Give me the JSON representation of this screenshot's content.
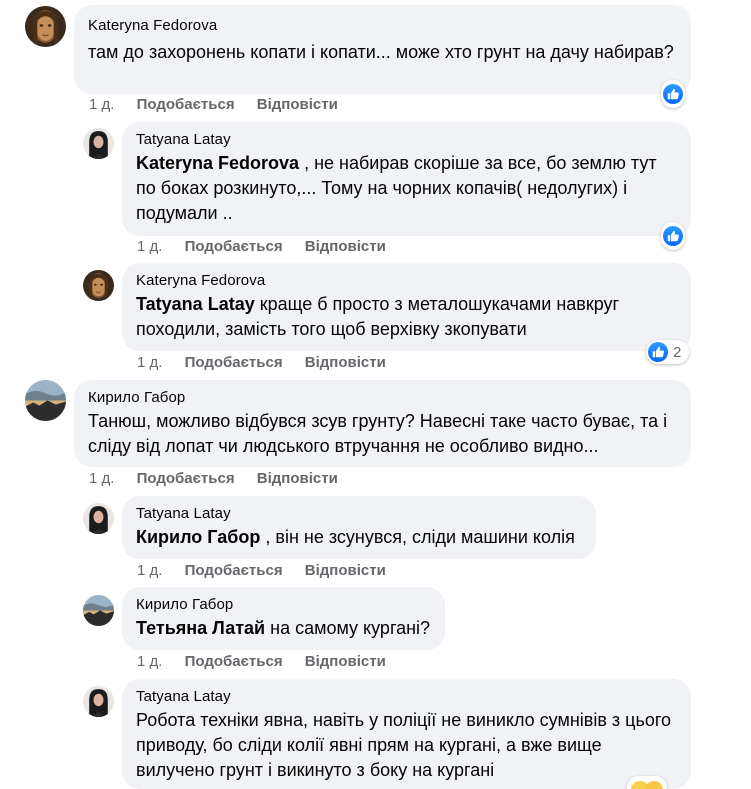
{
  "comments": [
    {
      "author": "Kateryna Fedorova",
      "text": "там до захоронень копати і копати... може хто грунт на дачу набирав?",
      "time": "1 д.",
      "like_label": "Подобається",
      "reply_label": "Відповісти",
      "reaction_icon": "like-icon",
      "avatar_icon": "portrait-avatar"
    },
    {
      "author": "Tatyana Latay",
      "mention": "Kateryna Fedorova",
      "text": " , не набирав скоріше за все, бо землю тут по боках розкинуто,... Тому на чорних копачів( недолугих) і подумали ..",
      "time": "1 д.",
      "like_label": "Подобається",
      "reply_label": "Відповісти",
      "reaction_icon": "like-icon",
      "avatar_icon": "woman-avatar"
    },
    {
      "author": "Kateryna Fedorova",
      "mention": "Tatyana Latay",
      "text": " краще б просто з металошукачами навкруг походили, замість того щоб верхівку зкопувати",
      "time": "1 д.",
      "like_label": "Подобається",
      "reply_label": "Відповісти",
      "reaction_icon": "like-icon",
      "reaction_count": "2",
      "avatar_icon": "portrait-avatar"
    },
    {
      "author": "Кирило Габор",
      "text": "Танюш, можливо відбувся зсув грунту? Навесні таке часто буває, та і сліду від лопат чи людського втручання не особливо видно...",
      "time": "1 д.",
      "like_label": "Подобається",
      "reply_label": "Відповісти",
      "avatar_icon": "sunset-avatar"
    },
    {
      "author": "Tatyana Latay",
      "mention": "Кирило Габор",
      "text": " , він не зсунувся, сліди машини колія",
      "time": "1 д.",
      "like_label": "Подобається",
      "reply_label": "Відповісти",
      "avatar_icon": "woman-avatar"
    },
    {
      "author": "Кирило Габор",
      "mention": "Тетьяна Латай",
      "text": " на самому кургані?",
      "time": "1 д.",
      "like_label": "Подобається",
      "reply_label": "Відповісти",
      "avatar_icon": "sunset-avatar"
    },
    {
      "author": "Tatyana Latay",
      "text": "Робота техніки явна, навіть у поліції не виникло сумнівів з цього приводу, бо сліди колії явні прям на кургані, а вже вище вилучено грунт і викинуто з боку на кургані",
      "avatar_icon": "woman-avatar"
    }
  ],
  "colors": {
    "bubble": "#f0f2f5",
    "text": "#050505",
    "meta": "#65676b",
    "like_blue": "#0866ff"
  }
}
